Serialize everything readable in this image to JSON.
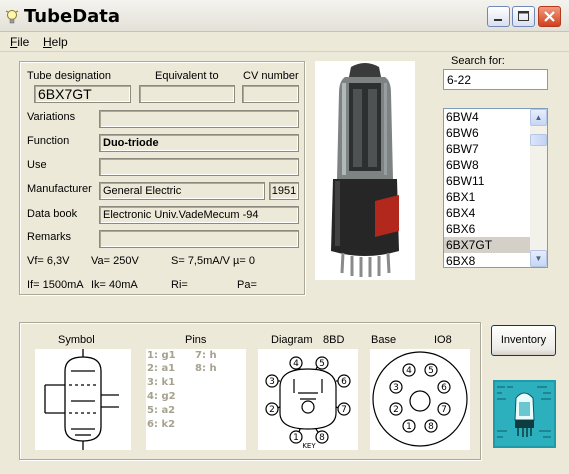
{
  "window": {
    "title": "TubeData"
  },
  "menu": [
    "File",
    "Help"
  ],
  "headers": {
    "designation": "Tube designation",
    "equivalent": "Equivalent to",
    "cv": "CV number"
  },
  "tube": {
    "designation": "6BX7GT",
    "equivalent": "",
    "cv": "",
    "variations": "",
    "function": "Duo-triode",
    "use": "",
    "manufacturer": "General Electric",
    "year": "1951",
    "databook": "Electronic Univ.VadeMecum -94",
    "remarks": ""
  },
  "labels": {
    "variations": "Variations",
    "function": "Function",
    "use": "Use",
    "manufacturer": "Manufacturer",
    "databook": "Data book",
    "remarks": "Remarks"
  },
  "electrical": {
    "vf": "Vf= 6,3V",
    "va": "Va= 250V",
    "s": "S= 7,5mA/V",
    "mu": "µ=   0",
    "if": "If= 1500mA",
    "ik": "Ik=  40mA",
    "ri": "Ri=",
    "pa": "Pa="
  },
  "search": {
    "label": "Search for:",
    "value": "6-22"
  },
  "tube_list": {
    "items": [
      "6BW4",
      "6BW6",
      "6BW7",
      "6BW8",
      "6BW11",
      "6BX1",
      "6BX4",
      "6BX6",
      "6BX7GT",
      "6BX8"
    ],
    "selected": "6BX7GT"
  },
  "bottom": {
    "symbol_label": "Symbol",
    "pins_label": "Pins",
    "diagram_label": "Diagram",
    "diagram_code": "8BD",
    "base_label": "Base",
    "base_code": "IO8"
  },
  "pins": {
    "col1": [
      "1: g1",
      "2: a1",
      "3: k1",
      "4: g2",
      "5: a2",
      "6: k2"
    ],
    "col2": [
      "7: h",
      "8: h"
    ]
  },
  "diagram": {
    "pin_numbers": [
      "1",
      "2",
      "3",
      "4",
      "5",
      "6",
      "7",
      "8"
    ],
    "key_text": "KEY"
  },
  "base": {
    "pin_numbers": [
      "1",
      "2",
      "3",
      "4",
      "5",
      "6",
      "7",
      "8"
    ]
  },
  "inventory_label": "Inventory",
  "colors": {
    "window_bg": "#ece9d8",
    "close_button": "#d2401d",
    "pin_text": "#a6a28f",
    "logo_bg": "#1e9aa8"
  }
}
